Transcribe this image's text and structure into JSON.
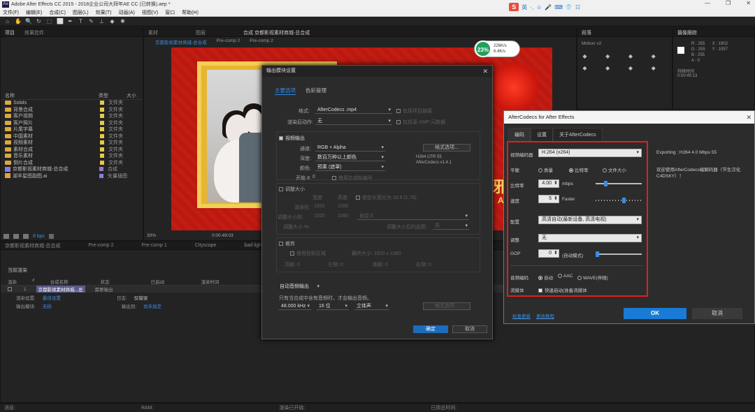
{
  "window": {
    "title": "Adobe After Effects CC 2015 - 2018企业公司大拜年AE CC (已转换).aep *",
    "min": "—",
    "max": "❐",
    "close": "✕"
  },
  "menu": [
    "文件(F)",
    "编辑(E)",
    "合成(C)",
    "图层(L)",
    "效果(T)",
    "动画(A)",
    "视图(V)",
    "窗口",
    "帮助(H)"
  ],
  "ime": {
    "logo": "S",
    "label": "英",
    "icons": [
      "·,",
      "☺",
      "🎤",
      "⌨",
      "👕",
      "☷"
    ]
  },
  "tools": [
    "⌂",
    "✋",
    "🔍",
    "↻",
    "⬚",
    "⬜",
    "✒",
    "T",
    "✎",
    "⊥",
    "◆",
    "✱"
  ],
  "project_panel": {
    "tabs": [
      "项目",
      "效果控件"
    ],
    "col_name": "名称",
    "col_type": "类型",
    "col_size": "大小",
    "items": [
      {
        "name": "Solids",
        "type": "文件夹",
        "kind": "folder"
      },
      {
        "name": "背景合成",
        "type": "文件夹",
        "kind": "folder"
      },
      {
        "name": "客户视频",
        "type": "文件夹",
        "kind": "folder"
      },
      {
        "name": "客户照片",
        "type": "文件夹",
        "kind": "folder"
      },
      {
        "name": "片尾字幕",
        "type": "文件夹",
        "kind": "folder"
      },
      {
        "name": "中国素材",
        "type": "文件夹",
        "kind": "folder"
      },
      {
        "name": "视频素材",
        "type": "文件夹",
        "kind": "folder"
      },
      {
        "name": "素材合成",
        "type": "文件夹",
        "kind": "folder"
      },
      {
        "name": "音乐素材",
        "type": "文件夹",
        "kind": "folder"
      },
      {
        "name": "倒片合成",
        "type": "文件夹",
        "kind": "folder"
      },
      {
        "name": "京都影视素材商城-总合成",
        "type": "合成",
        "kind": "comp"
      },
      {
        "name": "湖羊星图副图.ai",
        "type": "矢量插图",
        "kind": "ai"
      }
    ],
    "bpc": "8 bpc"
  },
  "viewer": {
    "tabs": [
      "素材",
      "图层",
      "合成 京都影视素材商城-总合成"
    ],
    "breadcrumbs": [
      "京都影视素材商城-总合成",
      "Pre-comp 2",
      "Pre-comp 2"
    ],
    "zoom": "30%",
    "timecode": "0:00:49:03"
  },
  "speed_gauge": {
    "percent": "23%",
    "up": "226K/s",
    "down": "6.4K/s"
  },
  "right_panels": {
    "panel1_title": "段落",
    "panel2_title": "摄像跟踪",
    "info": [
      "R : 255",
      "G : 255",
      "B : 255",
      "A : 0"
    ],
    "coords": [
      "X : 1902",
      "Y : 1057"
    ],
    "duration_label": "持续时间",
    "duration": "0:00:49:13",
    "motion_label": "Motion v2"
  },
  "timeline": {
    "tabs": [
      "京都影视素材商城-总合成",
      "Pre-comp 2",
      "Pre-comp 1",
      "Cityscape",
      "bad light 1 Comp 1"
    ],
    "render_queue_label": "当前渲染",
    "cols": [
      "渲染",
      "#",
      "合成名称",
      "状态",
      "已启动",
      "渲染时间"
    ],
    "row": {
      "num": "1",
      "name": "京都影视素材商城...总",
      "status": "需要输出"
    },
    "render_settings_label": "渲染设置:",
    "render_settings_value": "最佳设置",
    "output_module_label": "输出模块:",
    "output_module_value": "无损",
    "log_label": "日志:",
    "log_value": "仅错误",
    "output_to_label": "输出到:",
    "output_to_value": "尚未指定"
  },
  "status_bar": {
    "message": "消息:",
    "ram": "RAM:",
    "render_start": "渲染已开始:",
    "elapsed": "已用总时间:"
  },
  "output_module": {
    "title": "输出模块设置",
    "close": "✕",
    "tabs": [
      "主要选项",
      "色彩管理"
    ],
    "format_label": "格式:",
    "format_value": "AfterCodecs .mp4",
    "include_project": "包括项目链接",
    "post_render_label": "渲染后动作:",
    "post_render_value": "无",
    "include_xmp": "包括源 XMP 元数据",
    "video_output": "视频输出",
    "channels_label": "通道:",
    "channels_value": "RGB + Alpha",
    "depth_label": "深度:",
    "depth_value": "数百万种以上颜色",
    "color_label": "颜色:",
    "color_value": "预乘 (遮罩)",
    "start_label": "开始 #:",
    "start_value": "0",
    "use_comp_frame": "使用合成帧编号",
    "format_options_btn": "格式选项...",
    "codec_info": [
      "H264 CFR 55",
      "AfterCodecs v1.4.1"
    ],
    "resize_label": "调整大小",
    "resize_width": "宽度",
    "resize_height": "高度",
    "lock_aspect": "锁定长宽比为 16:9 (1.78)",
    "render_at_label": "渲染在:",
    "render_at": [
      "1920",
      "1080"
    ],
    "resize_to_label": "调整大小到:",
    "resize_to": [
      "1920",
      "1080"
    ],
    "resize_custom": "自定义",
    "resize_pct_label": "调整大小 %:",
    "resize_quality_label": "调整大小后的品质:",
    "resize_quality": "高",
    "crop_label": "裁剪",
    "use_roi": "使用目标区域",
    "final_size": "最终大小: 1920 x 1080",
    "crop_fields": [
      "顶部: 0",
      "左侧: 0",
      "底部: 0",
      "右侧: 0"
    ],
    "auto_audio": "自动音频输出",
    "audio_note": "只有当合成中含有音频时，才会输出音频。",
    "audio_rate": "48.000 kHz",
    "audio_bits": "16 位",
    "audio_channels": "立体声",
    "audio_format_btn": "格式选项...",
    "ok": "确定",
    "cancel": "取消"
  },
  "aftercodecs": {
    "title": "AfterCodecs for After Effects",
    "close": "✕",
    "tabs": [
      "编码",
      "设置",
      "关于AfterCodecs"
    ],
    "codec_label": "视频编码器",
    "codec_value": "H.264 (x264)",
    "balance_label": "平衡",
    "balance_options": [
      "质量",
      "比特率",
      "文件大小"
    ],
    "balance_selected": 1,
    "bitrate_label": "比特率",
    "bitrate_value": "4.00",
    "bitrate_unit": "mbps",
    "bitrate_level": 0.2,
    "speed_label": "速度",
    "speed_value": "5",
    "speed_unit": "Faster",
    "speed_level": 0.62,
    "profile_label": "配置",
    "profile_value": "高清自动(最新设备, 高清电视)",
    "tune_label": "调整",
    "tune_value": "无",
    "gop_label": "GOP",
    "gop_value": "0",
    "gop_unit": "(自动模式)",
    "gop_level": 0.0,
    "audio_label": "音频编码",
    "audio_options": [
      "自动",
      "AAC",
      "WAVE(伴随)"
    ],
    "audio_selected": 0,
    "stream_label": "流媒体",
    "stream_option": "快速启动(准备流媒体",
    "exporting": "Exporting : H264 4.0 Mbps 55",
    "welcome": "欢迎使用AfterCodecs编解码器（节生汉化C4DSKY）！",
    "link1": "检查更新",
    "link2": "更改教程",
    "ok": "OK",
    "cancel": "取消"
  },
  "composition_text": {
    "banner": "ART",
    "red_char": "邪"
  }
}
